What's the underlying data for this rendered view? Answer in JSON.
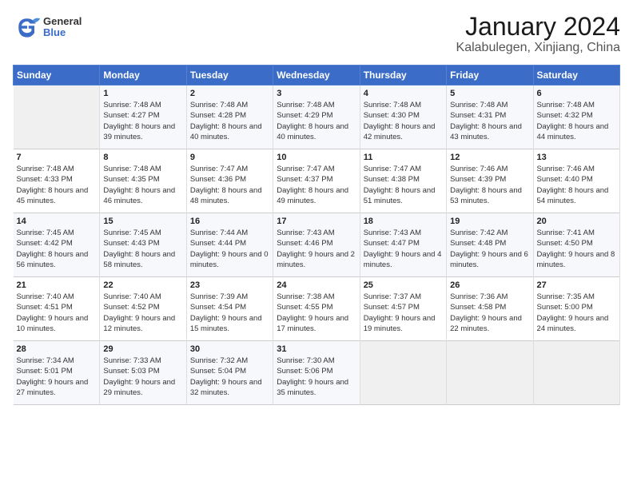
{
  "header": {
    "logo_text_general": "General",
    "logo_text_blue": "Blue",
    "month_title": "January 2024",
    "location": "Kalabulegen, Xinjiang, China"
  },
  "weekdays": [
    "Sunday",
    "Monday",
    "Tuesday",
    "Wednesday",
    "Thursday",
    "Friday",
    "Saturday"
  ],
  "weeks": [
    [
      {
        "day": "",
        "sunrise": "",
        "sunset": "",
        "daylight": ""
      },
      {
        "day": "1",
        "sunrise": "Sunrise: 7:48 AM",
        "sunset": "Sunset: 4:27 PM",
        "daylight": "Daylight: 8 hours and 39 minutes."
      },
      {
        "day": "2",
        "sunrise": "Sunrise: 7:48 AM",
        "sunset": "Sunset: 4:28 PM",
        "daylight": "Daylight: 8 hours and 40 minutes."
      },
      {
        "day": "3",
        "sunrise": "Sunrise: 7:48 AM",
        "sunset": "Sunset: 4:29 PM",
        "daylight": "Daylight: 8 hours and 40 minutes."
      },
      {
        "day": "4",
        "sunrise": "Sunrise: 7:48 AM",
        "sunset": "Sunset: 4:30 PM",
        "daylight": "Daylight: 8 hours and 42 minutes."
      },
      {
        "day": "5",
        "sunrise": "Sunrise: 7:48 AM",
        "sunset": "Sunset: 4:31 PM",
        "daylight": "Daylight: 8 hours and 43 minutes."
      },
      {
        "day": "6",
        "sunrise": "Sunrise: 7:48 AM",
        "sunset": "Sunset: 4:32 PM",
        "daylight": "Daylight: 8 hours and 44 minutes."
      }
    ],
    [
      {
        "day": "7",
        "sunrise": "Sunrise: 7:48 AM",
        "sunset": "Sunset: 4:33 PM",
        "daylight": "Daylight: 8 hours and 45 minutes."
      },
      {
        "day": "8",
        "sunrise": "Sunrise: 7:48 AM",
        "sunset": "Sunset: 4:35 PM",
        "daylight": "Daylight: 8 hours and 46 minutes."
      },
      {
        "day": "9",
        "sunrise": "Sunrise: 7:47 AM",
        "sunset": "Sunset: 4:36 PM",
        "daylight": "Daylight: 8 hours and 48 minutes."
      },
      {
        "day": "10",
        "sunrise": "Sunrise: 7:47 AM",
        "sunset": "Sunset: 4:37 PM",
        "daylight": "Daylight: 8 hours and 49 minutes."
      },
      {
        "day": "11",
        "sunrise": "Sunrise: 7:47 AM",
        "sunset": "Sunset: 4:38 PM",
        "daylight": "Daylight: 8 hours and 51 minutes."
      },
      {
        "day": "12",
        "sunrise": "Sunrise: 7:46 AM",
        "sunset": "Sunset: 4:39 PM",
        "daylight": "Daylight: 8 hours and 53 minutes."
      },
      {
        "day": "13",
        "sunrise": "Sunrise: 7:46 AM",
        "sunset": "Sunset: 4:40 PM",
        "daylight": "Daylight: 8 hours and 54 minutes."
      }
    ],
    [
      {
        "day": "14",
        "sunrise": "Sunrise: 7:45 AM",
        "sunset": "Sunset: 4:42 PM",
        "daylight": "Daylight: 8 hours and 56 minutes."
      },
      {
        "day": "15",
        "sunrise": "Sunrise: 7:45 AM",
        "sunset": "Sunset: 4:43 PM",
        "daylight": "Daylight: 8 hours and 58 minutes."
      },
      {
        "day": "16",
        "sunrise": "Sunrise: 7:44 AM",
        "sunset": "Sunset: 4:44 PM",
        "daylight": "Daylight: 9 hours and 0 minutes."
      },
      {
        "day": "17",
        "sunrise": "Sunrise: 7:43 AM",
        "sunset": "Sunset: 4:46 PM",
        "daylight": "Daylight: 9 hours and 2 minutes."
      },
      {
        "day": "18",
        "sunrise": "Sunrise: 7:43 AM",
        "sunset": "Sunset: 4:47 PM",
        "daylight": "Daylight: 9 hours and 4 minutes."
      },
      {
        "day": "19",
        "sunrise": "Sunrise: 7:42 AM",
        "sunset": "Sunset: 4:48 PM",
        "daylight": "Daylight: 9 hours and 6 minutes."
      },
      {
        "day": "20",
        "sunrise": "Sunrise: 7:41 AM",
        "sunset": "Sunset: 4:50 PM",
        "daylight": "Daylight: 9 hours and 8 minutes."
      }
    ],
    [
      {
        "day": "21",
        "sunrise": "Sunrise: 7:40 AM",
        "sunset": "Sunset: 4:51 PM",
        "daylight": "Daylight: 9 hours and 10 minutes."
      },
      {
        "day": "22",
        "sunrise": "Sunrise: 7:40 AM",
        "sunset": "Sunset: 4:52 PM",
        "daylight": "Daylight: 9 hours and 12 minutes."
      },
      {
        "day": "23",
        "sunrise": "Sunrise: 7:39 AM",
        "sunset": "Sunset: 4:54 PM",
        "daylight": "Daylight: 9 hours and 15 minutes."
      },
      {
        "day": "24",
        "sunrise": "Sunrise: 7:38 AM",
        "sunset": "Sunset: 4:55 PM",
        "daylight": "Daylight: 9 hours and 17 minutes."
      },
      {
        "day": "25",
        "sunrise": "Sunrise: 7:37 AM",
        "sunset": "Sunset: 4:57 PM",
        "daylight": "Daylight: 9 hours and 19 minutes."
      },
      {
        "day": "26",
        "sunrise": "Sunrise: 7:36 AM",
        "sunset": "Sunset: 4:58 PM",
        "daylight": "Daylight: 9 hours and 22 minutes."
      },
      {
        "day": "27",
        "sunrise": "Sunrise: 7:35 AM",
        "sunset": "Sunset: 5:00 PM",
        "daylight": "Daylight: 9 hours and 24 minutes."
      }
    ],
    [
      {
        "day": "28",
        "sunrise": "Sunrise: 7:34 AM",
        "sunset": "Sunset: 5:01 PM",
        "daylight": "Daylight: 9 hours and 27 minutes."
      },
      {
        "day": "29",
        "sunrise": "Sunrise: 7:33 AM",
        "sunset": "Sunset: 5:03 PM",
        "daylight": "Daylight: 9 hours and 29 minutes."
      },
      {
        "day": "30",
        "sunrise": "Sunrise: 7:32 AM",
        "sunset": "Sunset: 5:04 PM",
        "daylight": "Daylight: 9 hours and 32 minutes."
      },
      {
        "day": "31",
        "sunrise": "Sunrise: 7:30 AM",
        "sunset": "Sunset: 5:06 PM",
        "daylight": "Daylight: 9 hours and 35 minutes."
      },
      {
        "day": "",
        "sunrise": "",
        "sunset": "",
        "daylight": ""
      },
      {
        "day": "",
        "sunrise": "",
        "sunset": "",
        "daylight": ""
      },
      {
        "day": "",
        "sunrise": "",
        "sunset": "",
        "daylight": ""
      }
    ]
  ]
}
